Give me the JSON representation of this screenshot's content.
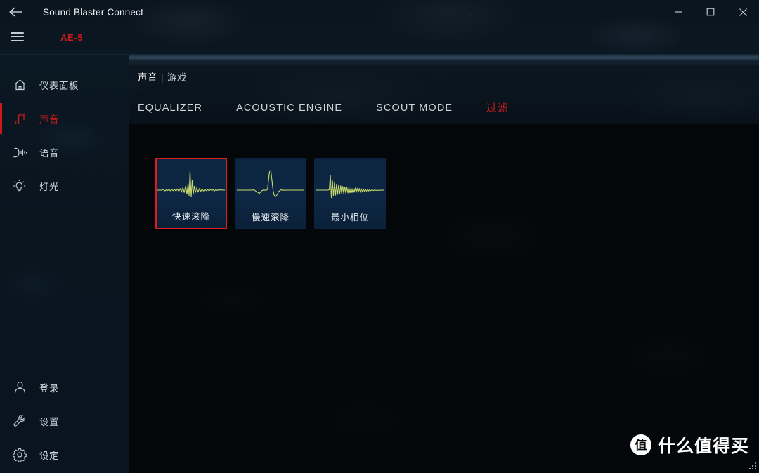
{
  "window": {
    "title": "Sound Blaster Connect",
    "back_icon": "back-arrow-icon",
    "minimize_label": "–",
    "maximize_label": "□",
    "close_label": "✕"
  },
  "menubar": {
    "hamburger_icon": "hamburger-menu-icon",
    "device": "AE-5"
  },
  "sidebar": {
    "top_items": [
      {
        "label": "仪表面板",
        "icon": "home-icon",
        "active": false
      },
      {
        "label": "声音",
        "icon": "music-note-icon",
        "active": true
      },
      {
        "label": "语音",
        "icon": "microphone-icon",
        "active": false
      },
      {
        "label": "灯光",
        "icon": "lightbulb-icon",
        "active": false
      }
    ],
    "bottom_items": [
      {
        "label": "登录",
        "icon": "user-icon"
      },
      {
        "label": "设置",
        "icon": "wrench-icon"
      },
      {
        "label": "设定",
        "icon": "gear-icon"
      }
    ]
  },
  "content": {
    "breadcrumb": {
      "primary": "声音",
      "separator": "|",
      "secondary": "游戏"
    },
    "tabs": [
      {
        "label": "EQUALIZER",
        "active": false
      },
      {
        "label": "ACOUSTIC ENGINE",
        "active": false
      },
      {
        "label": "SCOUT MODE",
        "active": false
      },
      {
        "label": "过滤",
        "active": true
      }
    ],
    "filter_cards": [
      {
        "label": "快速滚降",
        "waveform": "fast-rolloff-waveform",
        "selected": true
      },
      {
        "label": "慢速滚降",
        "waveform": "slow-rolloff-waveform",
        "selected": false
      },
      {
        "label": "最小相位",
        "waveform": "minimum-phase-waveform",
        "selected": false
      }
    ]
  },
  "watermark": {
    "badge": "值",
    "text": "什么值得买"
  },
  "colors": {
    "accent_red": "#cc1a1a",
    "selection_red": "#e01b1b",
    "card_bg": "#0d2744",
    "waveform": "#c8d96a",
    "sidebar_bg": "#0a1823",
    "header_bg": "#0b1721",
    "content_bg": "#040709"
  }
}
